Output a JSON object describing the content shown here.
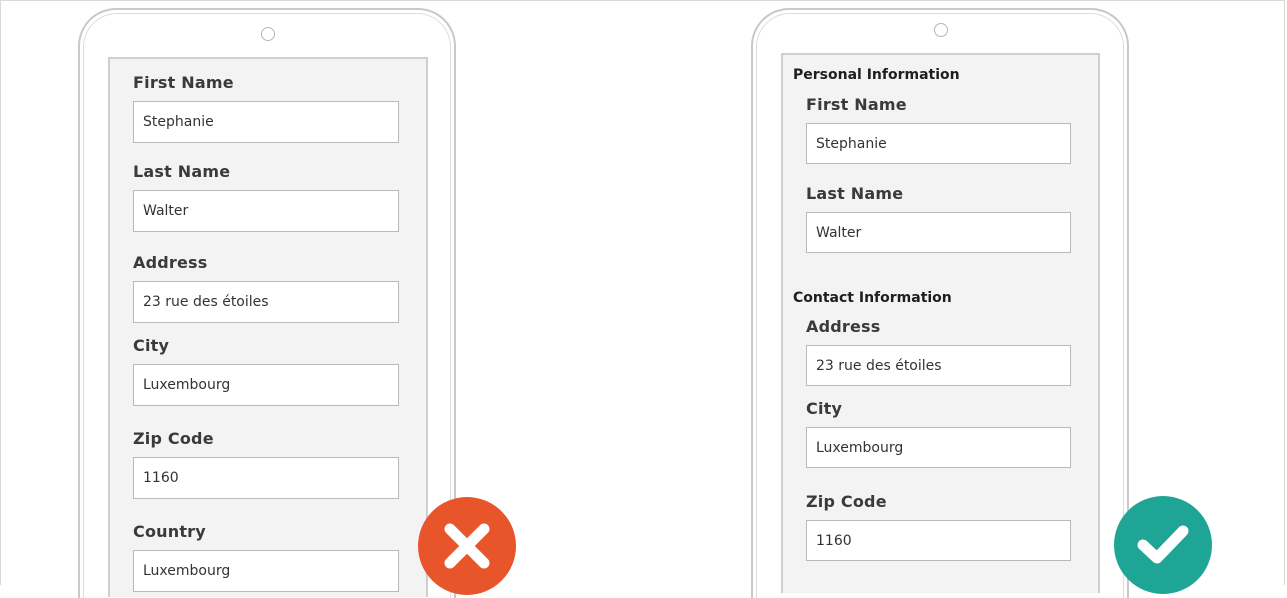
{
  "left_form": {
    "fields": [
      {
        "label": "First Name",
        "value": "Stephanie"
      },
      {
        "label": "Last Name",
        "value": "Walter"
      },
      {
        "label": "Address",
        "value": "23 rue des étoiles"
      },
      {
        "label": "City",
        "value": "Luxembourg"
      },
      {
        "label": "Zip Code",
        "value": "1160"
      },
      {
        "label": "Country",
        "value": "Luxembourg"
      }
    ],
    "verdict_icon": "x-mark-icon",
    "verdict_color": "#e8552b"
  },
  "right_form": {
    "sections": [
      {
        "title": "Personal Information",
        "fields": [
          {
            "label": "First Name",
            "value": "Stephanie"
          },
          {
            "label": "Last Name",
            "value": "Walter"
          }
        ]
      },
      {
        "title": "Contact Information",
        "fields": [
          {
            "label": "Address",
            "value": "23 rue des étoiles"
          },
          {
            "label": "City",
            "value": "Luxembourg"
          },
          {
            "label": "Zip Code",
            "value": "1160"
          }
        ]
      }
    ],
    "verdict_icon": "check-mark-icon",
    "verdict_color": "#1fa595"
  }
}
